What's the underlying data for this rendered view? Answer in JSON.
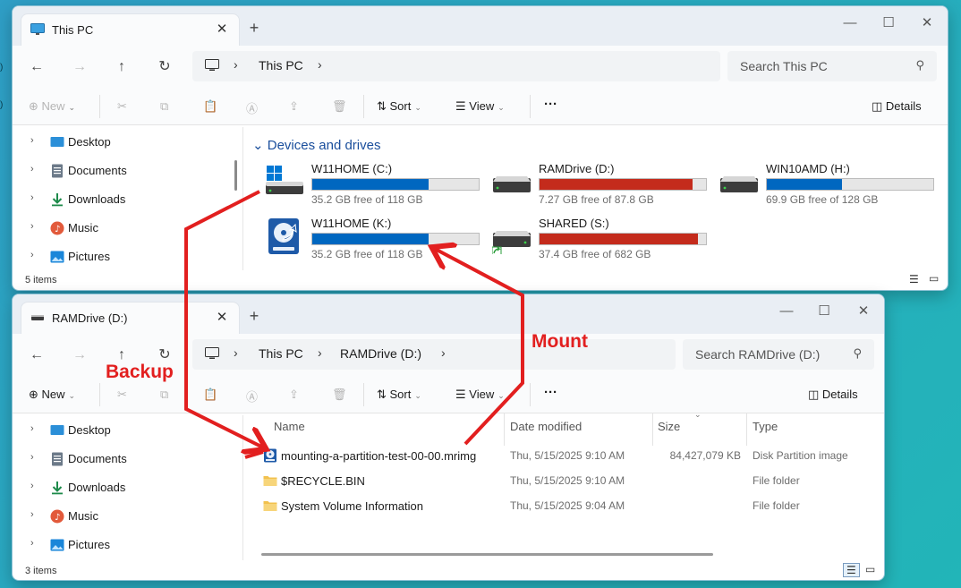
{
  "colors": {
    "accent": "#0067c0",
    "bar_full": "#c42b1c",
    "annotation": "#e21f1f"
  },
  "window_this_pc": {
    "tab_title": "This PC",
    "tab_icon": "monitor-icon",
    "breadcrumb": [
      "This PC"
    ],
    "search_placeholder": "Search This PC",
    "commands": {
      "new": "New",
      "sort": "Sort",
      "view": "View",
      "more": "···",
      "details": "Details"
    },
    "sidebar": [
      {
        "label": "Desktop",
        "icon": "desktop-icon"
      },
      {
        "label": "Documents",
        "icon": "documents-icon"
      },
      {
        "label": "Downloads",
        "icon": "downloads-icon"
      },
      {
        "label": "Music",
        "icon": "music-icon"
      },
      {
        "label": "Pictures",
        "icon": "pictures-icon"
      }
    ],
    "group_header": "Devices and drives",
    "drives": [
      {
        "name": "W11HOME (C:)",
        "free": "35.2 GB free of 118 GB",
        "used_fraction": 0.7,
        "full": false,
        "icon": "windows-drive-icon"
      },
      {
        "name": "RAMDrive (D:)",
        "free": "7.27 GB free of 87.8 GB",
        "used_fraction": 0.92,
        "full": true,
        "icon": "drive-icon"
      },
      {
        "name": "WIN10AMD (H:)",
        "free": "69.9 GB free of 128 GB",
        "used_fraction": 0.45,
        "full": false,
        "icon": "drive-icon"
      },
      {
        "name": "W11HOME (K:)",
        "free": "35.2 GB free of 118 GB",
        "used_fraction": 0.7,
        "full": false,
        "icon": "mounted-image-drive-icon"
      },
      {
        "name": "SHARED (S:)",
        "free": "37.4 GB free of 682 GB",
        "used_fraction": 0.95,
        "full": true,
        "icon": "network-drive-icon"
      }
    ],
    "status": "5 items"
  },
  "window_ramdrive": {
    "tab_title": "RAMDrive (D:)",
    "tab_icon": "drive-icon",
    "breadcrumb": [
      "This PC",
      "RAMDrive (D:)"
    ],
    "search_placeholder": "Search RAMDrive (D:)",
    "commands": {
      "new": "New",
      "sort": "Sort",
      "view": "View",
      "more": "···",
      "details": "Details"
    },
    "sidebar": [
      {
        "label": "Desktop",
        "icon": "desktop-icon"
      },
      {
        "label": "Documents",
        "icon": "documents-icon"
      },
      {
        "label": "Downloads",
        "icon": "downloads-icon"
      },
      {
        "label": "Music",
        "icon": "music-icon"
      },
      {
        "label": "Pictures",
        "icon": "pictures-icon"
      }
    ],
    "columns": {
      "name": "Name",
      "date": "Date modified",
      "size": "Size",
      "type": "Type"
    },
    "files": [
      {
        "name": "mounting-a-partition-test-00-00.mrimg",
        "date": "Thu, 5/15/2025 9:10 AM",
        "size": "84,427,079 KB",
        "type": "Disk Partition image",
        "icon": "disk-image-icon"
      },
      {
        "name": "$RECYCLE.BIN",
        "date": "Thu, 5/15/2025 9:10 AM",
        "size": "",
        "type": "File folder",
        "icon": "folder-icon"
      },
      {
        "name": "System Volume Information",
        "date": "Thu, 5/15/2025 9:04 AM",
        "size": "",
        "type": "File folder",
        "icon": "folder-icon"
      }
    ],
    "status": "3 items"
  },
  "annotations": {
    "backup": "Backup",
    "mount": "Mount"
  }
}
